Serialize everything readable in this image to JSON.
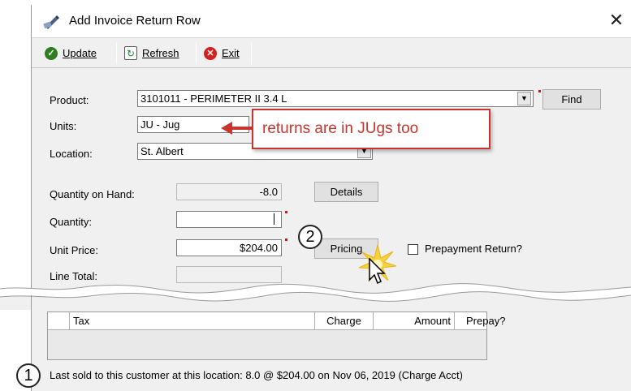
{
  "window": {
    "title": "Add Invoice Return Row",
    "close_glyph": "✕"
  },
  "toolbar": {
    "update_label": "Update",
    "refresh_label": "Refresh",
    "exit_label": "Exit"
  },
  "form": {
    "product_label": "Product:",
    "product_value": "3101011 - PERIMETER II 3.4 L",
    "find_label": "Find",
    "units_label": "Units:",
    "units_value": "JU - Jug",
    "location_label": "Location:",
    "location_value": "St. Albert",
    "qoh_label": "Quantity on Hand:",
    "qoh_value": "-8.0",
    "details_label": "Details",
    "quantity_label": "Quantity:",
    "quantity_value": "",
    "unit_price_label": "Unit Price:",
    "unit_price_value": "$204.00",
    "pricing_label": "Pricing",
    "prepayment_label": "Prepayment Return?",
    "prepayment_checked": false,
    "line_total_label": "Line Total:"
  },
  "annotation": {
    "callout_text": "returns are in JUgs too",
    "marker_1": "1",
    "marker_2": "2",
    "callout_color": "#c8352d"
  },
  "tax_grid": {
    "columns": [
      "Tax",
      "Charge",
      "Amount",
      "Prepay?"
    ]
  },
  "status": {
    "last_sold": "Last sold to this customer at this location: 8.0 @ $204.00 on Nov 06, 2019 (Charge Acct)"
  }
}
